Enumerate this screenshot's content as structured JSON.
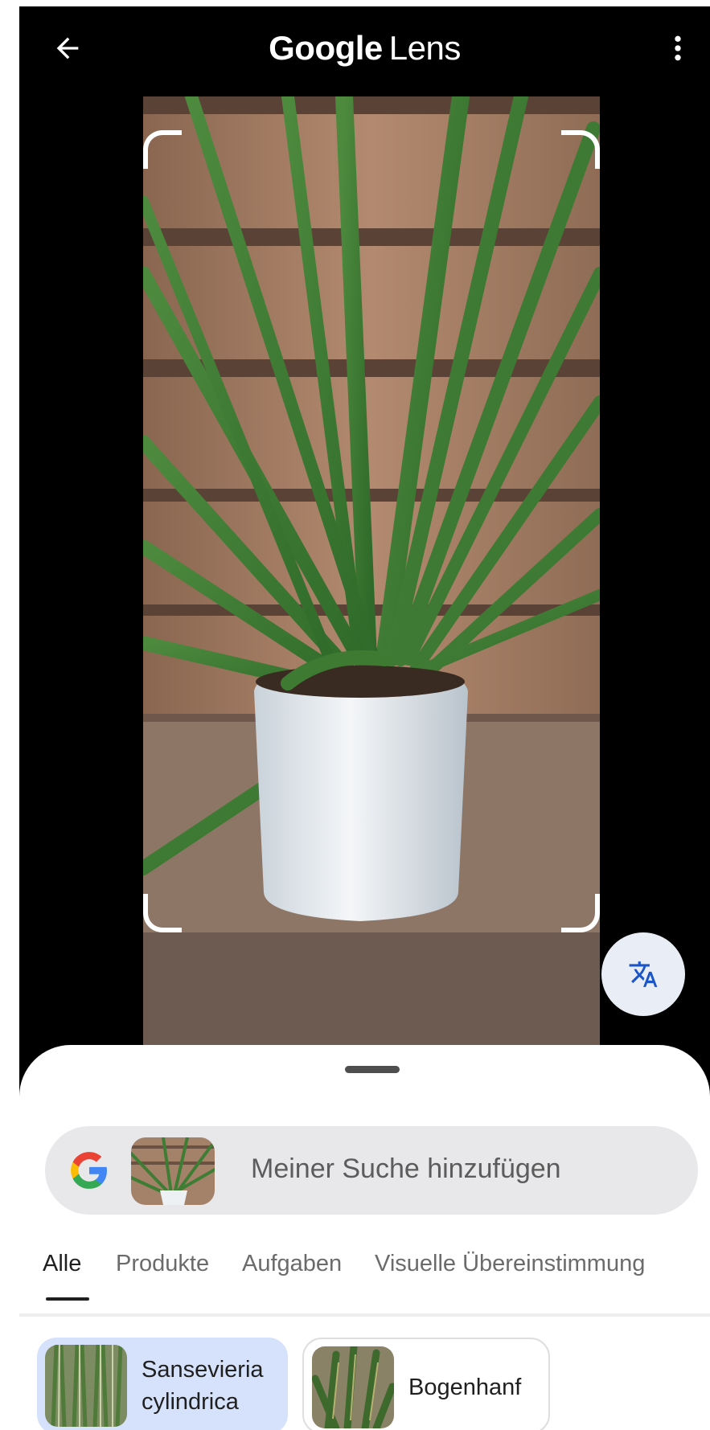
{
  "header": {
    "back_label": "Zurück",
    "title_brand": "Google",
    "title_product": "Lens",
    "more_label": "Weitere Optionen"
  },
  "viewer": {
    "translate_label": "Übersetzen"
  },
  "search": {
    "placeholder": "Meiner Suche hinzufügen"
  },
  "tabs": [
    {
      "label": "Alle",
      "active": true
    },
    {
      "label": "Produkte",
      "active": false
    },
    {
      "label": "Aufgaben",
      "active": false
    },
    {
      "label": "Visuelle Übereinstimmung",
      "active": false
    }
  ],
  "results": {
    "chips": [
      {
        "label": "Sansevieria cylindrica",
        "selected": true
      },
      {
        "label": "Bogenhanf",
        "selected": false
      }
    ]
  },
  "colors": {
    "accent_chip": "#d6e2fb",
    "fab": "#e9eef6",
    "search_bg": "#e8e8ea",
    "google_blue": "#4285f4",
    "google_red": "#ea4335",
    "google_yellow": "#fbbc05",
    "google_green": "#34a853"
  },
  "icons": {
    "back": "arrow-left-icon",
    "more": "more-vert-icon",
    "translate": "translate-icon",
    "google": "google-g-icon"
  }
}
